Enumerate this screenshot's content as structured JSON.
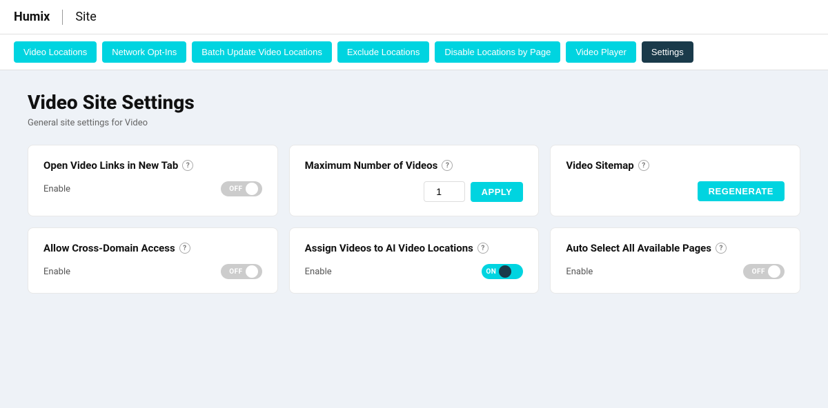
{
  "header": {
    "brand": "Humix",
    "separator": "|",
    "site": "Site"
  },
  "nav": {
    "items": [
      {
        "id": "video-locations",
        "label": "Video Locations",
        "active": false
      },
      {
        "id": "network-opt-ins",
        "label": "Network Opt-Ins",
        "active": false
      },
      {
        "id": "batch-update",
        "label": "Batch Update Video Locations",
        "active": false
      },
      {
        "id": "exclude-locations",
        "label": "Exclude Locations",
        "active": false
      },
      {
        "id": "disable-locations",
        "label": "Disable Locations by Page",
        "active": false
      },
      {
        "id": "video-player",
        "label": "Video Player",
        "active": false
      },
      {
        "id": "settings",
        "label": "Settings",
        "active": true
      }
    ]
  },
  "page": {
    "title": "Video Site Settings",
    "subtitle": "General site settings for Video"
  },
  "settings": [
    {
      "id": "open-video-links",
      "title": "Open Video Links in New Tab",
      "help": "?",
      "label": "Enable",
      "toggle": "off",
      "type": "toggle"
    },
    {
      "id": "max-videos",
      "title": "Maximum Number of Videos",
      "help": "?",
      "value": "1",
      "apply_label": "APPLY",
      "type": "number-input"
    },
    {
      "id": "video-sitemap",
      "title": "Video Sitemap",
      "help": "?",
      "regen_label": "REGENERATE",
      "type": "regenerate"
    },
    {
      "id": "cross-domain",
      "title": "Allow Cross-Domain Access",
      "help": "?",
      "label": "Enable",
      "toggle": "off",
      "type": "toggle"
    },
    {
      "id": "assign-videos",
      "title": "Assign Videos to AI Video Locations",
      "help": "?",
      "label": "Enable",
      "toggle": "on",
      "type": "toggle"
    },
    {
      "id": "auto-select",
      "title": "Auto Select All Available Pages",
      "help": "?",
      "label": "Enable",
      "toggle": "off",
      "type": "toggle"
    }
  ],
  "icons": {
    "help": "?"
  }
}
